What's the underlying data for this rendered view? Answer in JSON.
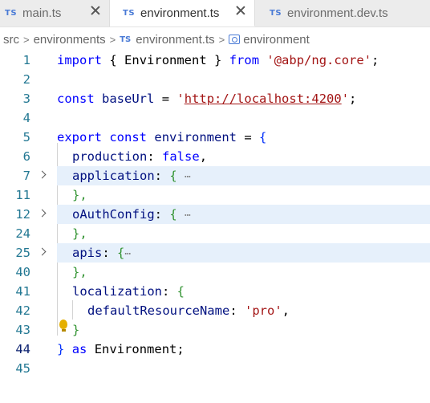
{
  "tabs": [
    {
      "icon": "TS",
      "label": "main.ts",
      "active": false,
      "has_close": true
    },
    {
      "icon": "TS",
      "label": "environment.ts",
      "active": true,
      "has_close": true
    },
    {
      "icon": "TS",
      "label": "environment.dev.ts",
      "active": false,
      "has_close": false
    }
  ],
  "breadcrumb": {
    "part1": "src",
    "part2": "environments",
    "file_icon": "TS",
    "part3": "environment.ts",
    "symbol_icon": "symbol-variable-icon",
    "part4": "environment"
  },
  "editor": {
    "lines": [
      {
        "number": "1"
      },
      {
        "number": "2"
      },
      {
        "number": "3"
      },
      {
        "number": "4"
      },
      {
        "number": "5"
      },
      {
        "number": "6"
      },
      {
        "number": "7"
      },
      {
        "number": "11"
      },
      {
        "number": "12"
      },
      {
        "number": "24"
      },
      {
        "number": "25"
      },
      {
        "number": "40"
      },
      {
        "number": "41"
      },
      {
        "number": "42"
      },
      {
        "number": "43"
      },
      {
        "number": "44"
      },
      {
        "number": "45"
      }
    ],
    "tokens": {
      "import_kw": "import",
      "open_brace": "{",
      "environment_type": "Environment",
      "close_brace": "}",
      "from_kw": "from",
      "module_path": "'@abp/ng.core'",
      "semicolon": ";",
      "const_kw": "const",
      "baseurl_name": "baseUrl",
      "equals": "=",
      "quote": "'",
      "url": "http://localhost:4200",
      "export_kw": "export",
      "environment_name": "environment",
      "production_prop": "production",
      "colon": ":",
      "false_kw": "false",
      "comma": ",",
      "application_prop": "application",
      "ellipsis": "⋯",
      "close_brace_comma": "},",
      "oauth_prop": "oAuthConfig",
      "apis_prop": "apis",
      "localization_prop": "localization",
      "default_resource_prop": "defaultResourceName",
      "pro_value": "'pro'",
      "as_kw": "as",
      "environment_type_end": "Environment;"
    }
  },
  "colors": {
    "keyword": "#0000ff",
    "string": "#a31515",
    "property": "#001080",
    "line_number": "#237893",
    "fold_highlight": "#e6f0fb",
    "ts_icon": "#4a7bd6",
    "lightbulb": "#e5b000"
  }
}
